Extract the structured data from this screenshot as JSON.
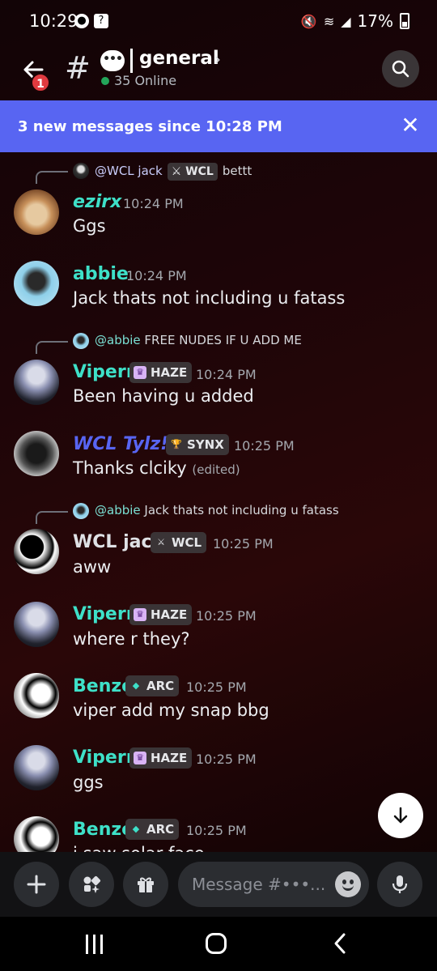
{
  "status_bar": {
    "time": "10:29",
    "battery": "17%",
    "left_icons": [
      "settings-icon",
      "notification-icon"
    ]
  },
  "header": {
    "notification_count": "1",
    "channel_emoji": "•••",
    "channel_name": "general",
    "online": "35 Online"
  },
  "banner": {
    "text": "3 new messages since 10:28 PM"
  },
  "messages": [
    {
      "reply": {
        "user": "@WCL jack",
        "tag": "WCL",
        "text": "bettt"
      },
      "user": "ezirx",
      "user_color": "#3ee0c8",
      "time": "10:24 PM",
      "text": "Ggs"
    },
    {
      "user": "abbie",
      "user_color": "#3ee0c8",
      "time": "10:24 PM",
      "text": "Jack thats not including u fatass"
    },
    {
      "reply": {
        "user": "@abbie",
        "text": "FREE NUDES IF U ADD ME"
      },
      "user": "Viperr",
      "user_color": "#3ee0c8",
      "tag": "HAZE",
      "time": "10:24 PM",
      "text": "Been having u added"
    },
    {
      "user": "WCL Tylz!",
      "user_color": "#5865f2",
      "tag": "SYNX",
      "time": "10:25 PM",
      "text": "Thanks clciky",
      "edited": "(edited)"
    },
    {
      "reply": {
        "user": "@abbie",
        "text": "Jack thats not including u fatass"
      },
      "user": "WCL jack",
      "user_color": "#dfe1e5",
      "tag": "WCL",
      "time": "10:25 PM",
      "text": "aww"
    },
    {
      "user": "Viperr",
      "user_color": "#3ee0c8",
      "tag": "HAZE",
      "time": "10:25 PM",
      "text": "where r they?"
    },
    {
      "user": "Benze",
      "user_color": "#3ee0c8",
      "tag": "ARC",
      "time": "10:25 PM",
      "text": "viper add my snap bbg"
    },
    {
      "user": "Viperr",
      "user_color": "#3ee0c8",
      "tag": "HAZE",
      "time": "10:25 PM",
      "text": "ggs"
    },
    {
      "user": "Benze",
      "user_color": "#3ee0c8",
      "tag": "ARC",
      "time": "10:25 PM",
      "text": "i saw solar face"
    }
  ],
  "composer": {
    "placeholder": "Message #•••..."
  }
}
